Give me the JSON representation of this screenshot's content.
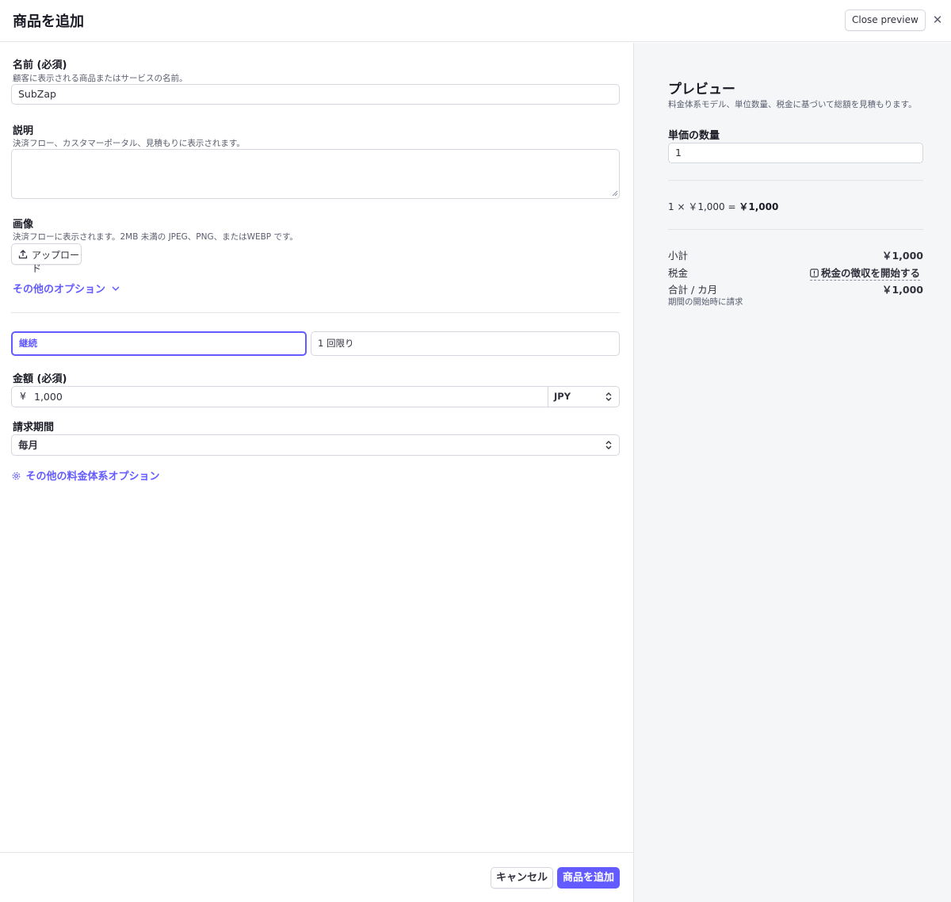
{
  "header": {
    "title": "商品を追加",
    "close_preview_label": "Close preview",
    "close_symbol": "✕"
  },
  "form": {
    "name": {
      "label": "名前 (必須)",
      "hint": "顧客に表示される商品またはサービスの名前。",
      "value": "SubZap"
    },
    "description": {
      "label": "説明",
      "hint": "決済フロー、カスタマーポータル、見積もりに表示されます。",
      "value": ""
    },
    "image": {
      "label": "画像",
      "hint": "決済フローに表示されます。2MB 未満の JPEG、PNG、またはWEBP です。",
      "upload_label": "アップロード"
    },
    "more_options_label": "その他のオプション",
    "pricing_type": {
      "recurring_label": "継続",
      "one_time_label": "1 回限り",
      "selected": "継続"
    },
    "amount": {
      "label": "金額 (必須)",
      "currency_symbol": "¥",
      "value": "1,000",
      "currency": "JPY"
    },
    "billing_period": {
      "label": "請求期間",
      "value": "毎月"
    },
    "more_pricing_options_label": "その他の料金体系オプション"
  },
  "footer": {
    "cancel_label": "キャンセル",
    "add_label": "商品を追加"
  },
  "preview": {
    "title": "プレビュー",
    "hint": "料金体系モデル、単位数量、税金に基づいて総額を見積もります。",
    "unit_quantity_label": "単価の数量",
    "unit_quantity_value": "1",
    "calc_prefix": "1 × ￥1,000 =",
    "calc_result": "￥1,000",
    "subtotal_label": "小計",
    "subtotal_value": "￥1,000",
    "tax_label": "税金",
    "tax_link": "税金の徴収を開始する",
    "total_label": "合計 / カ月",
    "total_value": "￥1,000",
    "billing_note": "期間の開始時に請求"
  },
  "colors": {
    "accent": "#635bff",
    "border": "#d5d7de",
    "preview_bg": "#f5f6f8"
  }
}
